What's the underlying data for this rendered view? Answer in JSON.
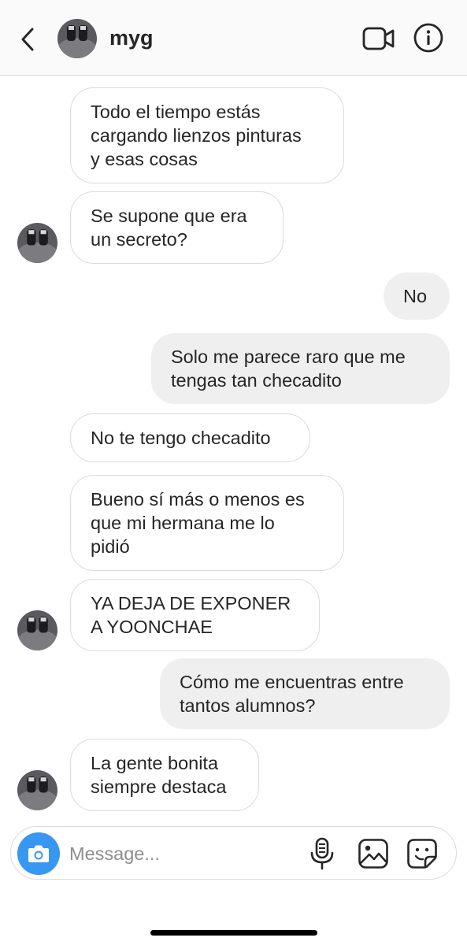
{
  "header": {
    "contact_name": "myg",
    "back_icon": "chevron-left-icon",
    "video_icon": "video-camera-icon",
    "info_icon": "info-icon"
  },
  "messages": [
    {
      "side": "received",
      "text": "Todo el tiempo estás\ncargando lienzos pinturas\ny esas cosas"
    },
    {
      "side": "received",
      "text": "Se supone que era\nun secreto?",
      "avatar": true
    },
    {
      "side": "sent",
      "text": "No"
    },
    {
      "side": "sent",
      "text": "Solo me parece raro que me\ntengas tan checadito"
    },
    {
      "side": "received",
      "text": "No te tengo checadito"
    },
    {
      "side": "received",
      "text": "Bueno sí más o menos es\nque mi hermana me lo\npidió"
    },
    {
      "side": "received",
      "text": "YA DEJA DE EXPONER\nA YOONCHAE",
      "avatar": true
    },
    {
      "side": "sent",
      "text": "Cómo me encuentras entre\ntantos alumnos?"
    },
    {
      "side": "received",
      "text": "La gente bonita\nsiempre destaca",
      "avatar": true
    }
  ],
  "composer": {
    "placeholder": "Message...",
    "camera_icon": "camera-icon",
    "mic_icon": "microphone-icon",
    "gallery_icon": "gallery-icon",
    "sticker_icon": "sticker-icon"
  },
  "colors": {
    "accent": "#3897f0",
    "sent_bubble": "#efefef",
    "received_border": "#dbdbdb",
    "text": "#262626",
    "placeholder": "#8e8e8e"
  }
}
